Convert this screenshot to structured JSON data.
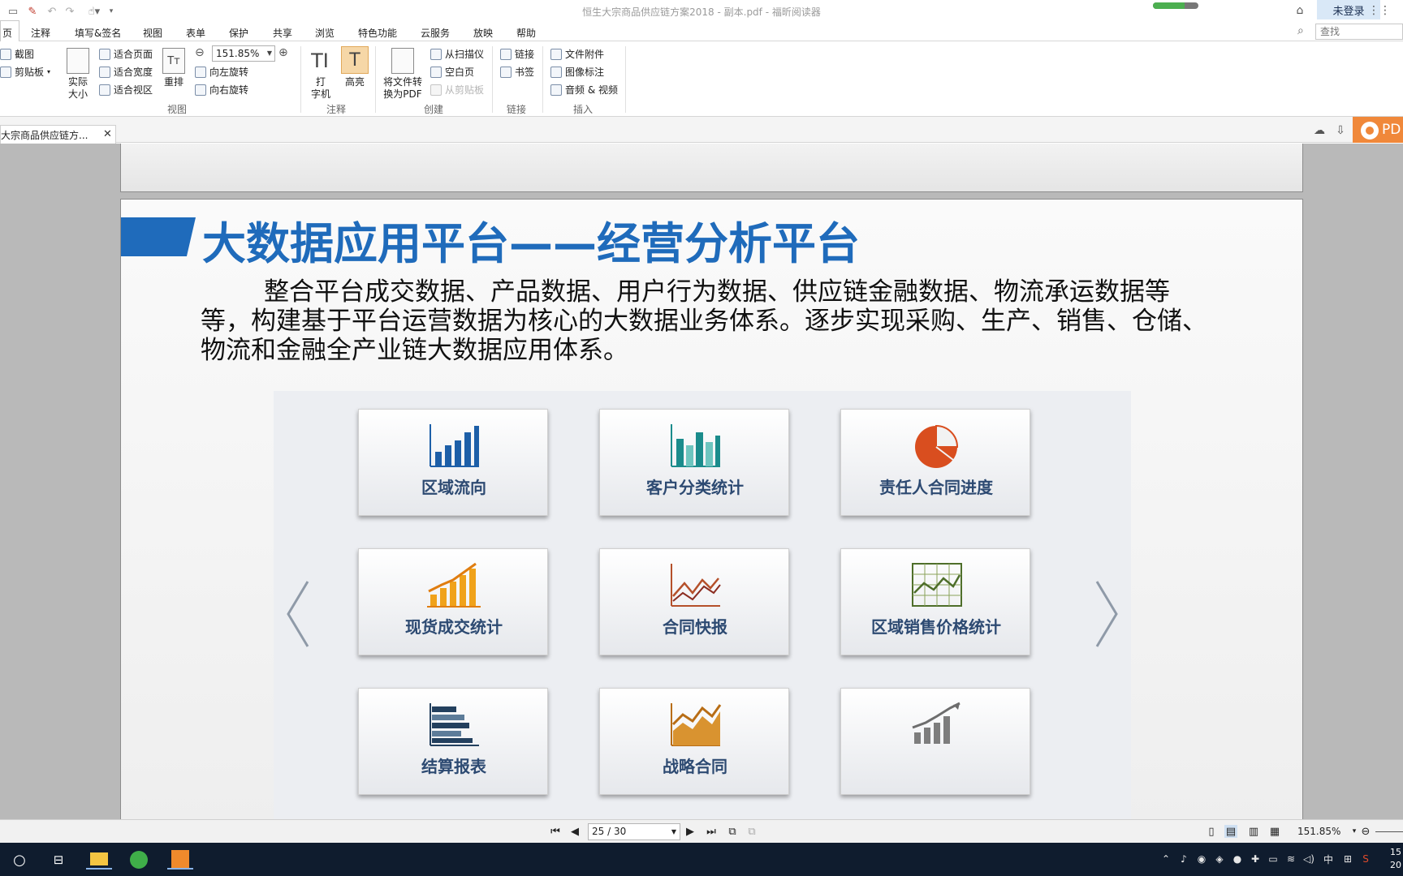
{
  "window": {
    "title": "恒生大宗商品供应链方案2018 - 副本.pdf - 福昕阅读器",
    "login": "未登录",
    "progress_percent": 70
  },
  "menu_tabs": [
    "页",
    "注释",
    "填写&签名",
    "视图",
    "表单",
    "保护",
    "共享",
    "浏览",
    "特色功能",
    "云服务",
    "放映",
    "帮助"
  ],
  "search": {
    "placeholder": "查找"
  },
  "ribbon": {
    "small": {
      "screenshot": "截图",
      "clipboard": "剪贴板",
      "fit_page": "适合页面",
      "fit_width": "适合宽度",
      "fit_visible": "适合视区",
      "rotate_left": "向左旋转",
      "rotate_right": "向右旋转",
      "from_scanner": "从扫描仪",
      "blank_page": "空白页",
      "from_clipboard": "从剪贴板",
      "link": "链接",
      "bookmark": "书签",
      "file_attachment": "文件附件",
      "image_annotation": "图像标注",
      "audio_video": "音频 & 视频"
    },
    "big": {
      "actual_size_1": "实际",
      "actual_size_2": "大小",
      "reflow": "重排",
      "typewriter_1": "打",
      "typewriter_2": "字机",
      "highlight": "高亮",
      "convert_1": "将文件转",
      "convert_2": "换为PDF"
    },
    "zoom_value": "151.85%",
    "groups": {
      "view": "视图",
      "comment": "注释",
      "create": "创建",
      "links": "链接",
      "insert": "插入"
    }
  },
  "doc_tab": {
    "label": "大宗商品供应链方...",
    "close": "✕"
  },
  "brand_button": "PD",
  "slide": {
    "title": "大数据应用平台——经营分析平台",
    "body_lines": [
      "整合平台成交数据、产品数据、用户行为数据、供应链金融数据、物流承运数据等",
      "等，构建基于平台运营数据为核心的大数据业务体系。逐步实现采购、生产、销售、仓储、",
      "物流和金融全产业链大数据应用体系。"
    ],
    "tiles": [
      {
        "label": "区域流向",
        "icon": "bar-chart-blue-icon"
      },
      {
        "label": "客户分类统计",
        "icon": "bar-chart-teal-icon"
      },
      {
        "label": "责任人合同进度",
        "icon": "pie-chart-icon"
      },
      {
        "label": "现货成交统计",
        "icon": "bar-trend-orange-icon"
      },
      {
        "label": "合同快报",
        "icon": "line-trend-icon"
      },
      {
        "label": "区域销售价格统计",
        "icon": "grid-line-chart-icon"
      },
      {
        "label": "结算报表",
        "icon": "horizontal-bar-icon"
      },
      {
        "label": "战略合同",
        "icon": "area-chart-icon"
      },
      {
        "label": "",
        "icon": "grey-growth-icon"
      }
    ],
    "colors": {
      "title_blue": "#1f6bbb",
      "tile_text": "#2d4a72"
    }
  },
  "navigation": {
    "page_value": "25 / 30",
    "zoom": "151.85%"
  },
  "taskbar": {
    "ime": "中",
    "clock_1": "15",
    "clock_2": "20"
  }
}
